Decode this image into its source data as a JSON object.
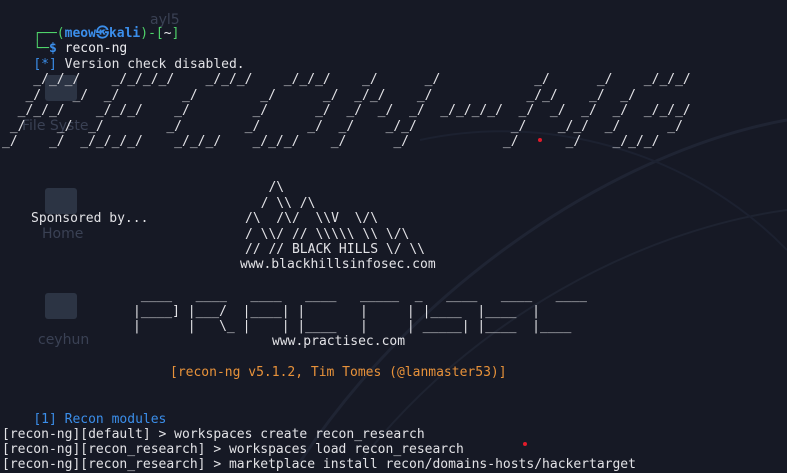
{
  "prompt": {
    "corner_top": "┌──(",
    "user": "meow",
    "at_symbol": "㉿",
    "host": "kali",
    "mid": ")-[",
    "cwd": "~",
    "close": "]",
    "corner_bottom": "└─",
    "dollar": "$",
    "command": "recon-ng"
  },
  "output": {
    "version_prefix": "[*]",
    "version_text": " Version check disabled."
  },
  "banner": {
    "art": "    _/_/_/    _/_/_/_/    _/_/_/    _/_/_/    _/      _/            _/      _/    _/_/_/\n   _/    _/  _/        _/        _/      _/  _/_/    _/            _/_/    _/  _/\n  _/_/_/    _/_/_/    _/        _/      _/  _/  _/  _/  _/_/_/_/  _/  _/  _/  _/  _/_/_/\n _/    _/  _/        _/        _/      _/  _/    _/_/            _/    _/_/  _/      _/\n_/    _/  _/_/_/_/    _/_/_/    _/_/_/    _/      _/            _/      _/    _/_/_/"
  },
  "sponsor": {
    "label": "Sponsored by...",
    "bhis_art": "   /\\\n  / \\\\ /\\\n/\\  /\\/  \\\\V  \\/\\\n/ \\\\/ // \\\\\\\\\\ \\\\ \\/\\\n// // BLACK HILLS \\/ \\\\",
    "bhis_url": "www.blackhillsinfosec.com",
    "practisec_art": " ____   ____   ____   ____   _____  _   ____   ____   ____\n|____] |___/  |____| |       |     | |____  |____  |\n|      |   \\_ |    | |____   |     | _____| |____  |____",
    "practisec_url": "www.practisec.com"
  },
  "version_line": "[recon-ng v5.1.2, Tim Tomes (@lanmaster53)]",
  "modules": {
    "count": "[1]",
    "label": " Recon modules"
  },
  "commands": [
    "[recon-ng][default] > workspaces create recon_research",
    "[recon-ng][recon_research] > workspaces load recon_research",
    "[recon-ng][recon_research] > marketplace install recon/domains-hosts/hackertarget"
  ],
  "desktop": {
    "file_system_label": "File Syste",
    "home_label": "Home",
    "user_label": "ceyhun",
    "top_label": "ayl5"
  },
  "colors": {
    "background": "#161925",
    "prompt_blue": "#3b8eea",
    "prompt_green": "#4fd36a",
    "orange": "#e8923a",
    "red_dot": "#e21b2a"
  }
}
